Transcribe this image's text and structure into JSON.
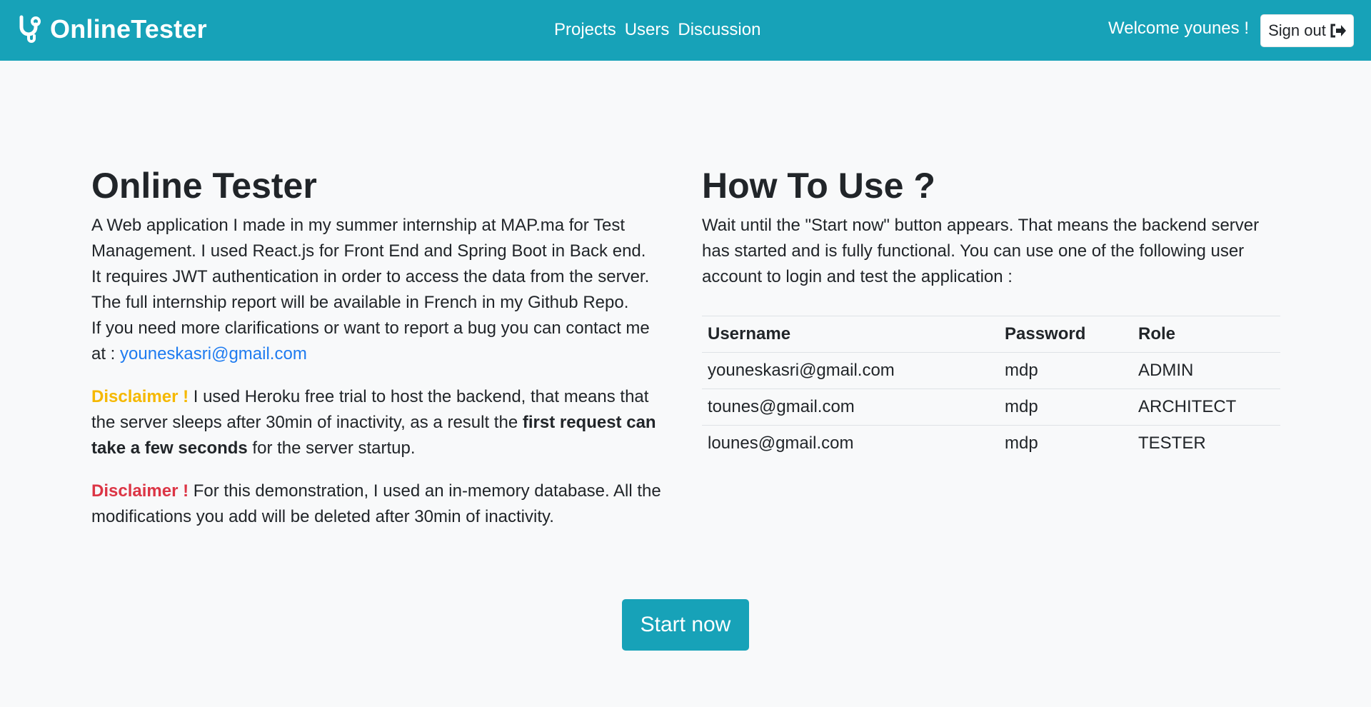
{
  "navbar": {
    "brand": "OnlineTester",
    "links": [
      "Projects",
      "Users",
      "Discussion"
    ],
    "welcome": "Welcome younes !",
    "signout": "Sign out",
    "color": "#17a2b8"
  },
  "about": {
    "title": "Online Tester",
    "lines": [
      "A Web application I made in my summer internship at MAP.ma for Test Management. I used React.js for Front End and Spring Boot in Back end.",
      "It requires JWT authentication in order to access the data from the server.",
      "The full internship report will be available in French in my Github Repo."
    ],
    "contact_text": "If you need more clarifications or want to report a bug you can contact me at : ",
    "contact_email": "youneskasri@gmail.com",
    "disclaimer1": {
      "label": "Disclaimer !",
      "text1": " I used Heroku free trial to host the backend, that means that the server sleeps after 30min of inactivity, as a result the ",
      "bold": "first request can take a few seconds",
      "text2": " for the server startup."
    },
    "disclaimer2": {
      "label": "Disclaimer !",
      "text": " For this demonstration, I used an in-memory database. All the modifications you add will be deleted after 30min of inactivity."
    }
  },
  "howto": {
    "title": "How To Use ?",
    "text": "Wait until the \"Start now\" button appears. That means the backend server has started and is fully functional. You can use one of the following user account to login and test the application :",
    "headers": [
      "Username",
      "Password",
      "Role"
    ],
    "rows": [
      [
        "youneskasri@gmail.com",
        "mdp",
        "ADMIN"
      ],
      [
        "tounes@gmail.com",
        "mdp",
        "ARCHITECT"
      ],
      [
        "lounes@gmail.com",
        "mdp",
        "TESTER"
      ]
    ]
  },
  "start_button": "Start now",
  "colors": {
    "warning": "#f5b800",
    "danger": "#dc3545",
    "link": "#1e7bf0"
  },
  "icons": {
    "brand": "stethoscope-icon",
    "signout": "sign-out-icon"
  }
}
